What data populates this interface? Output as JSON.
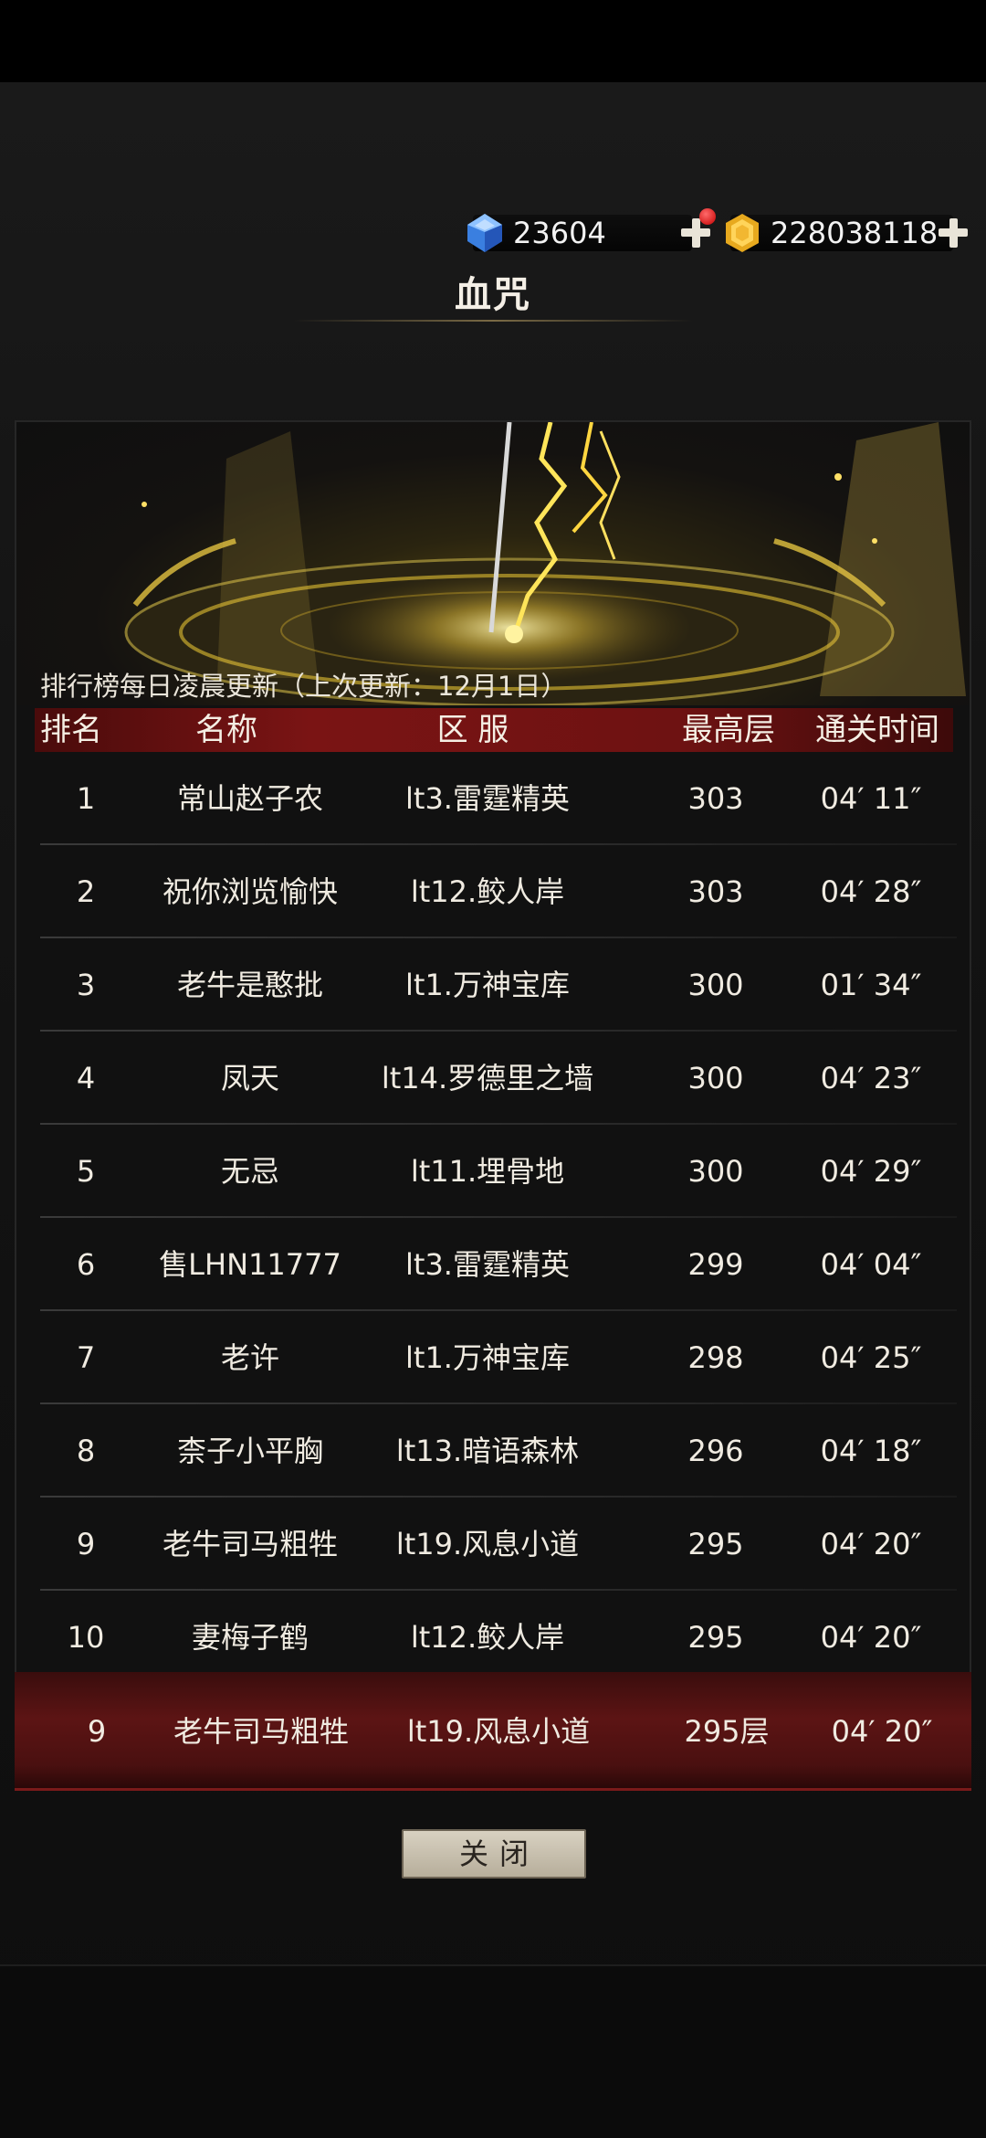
{
  "currency": {
    "gems": "23604",
    "gold": "228038118"
  },
  "title": "血咒",
  "update_note": "排行榜每日凌晨更新（上次更新：12月1日）",
  "headers": {
    "rank": "排名",
    "name": "名称",
    "server": "区 服",
    "floor": "最高层",
    "time": "通关时间"
  },
  "rows": [
    {
      "rank": "1",
      "name": "常山赵子农",
      "server": "lt3.雷霆精英",
      "floor": "303",
      "time": "04′ 11″"
    },
    {
      "rank": "2",
      "name": "祝你浏览愉快",
      "server": "lt12.鲛人岸",
      "floor": "303",
      "time": "04′ 28″"
    },
    {
      "rank": "3",
      "name": "老牛是憨批",
      "server": "lt1.万神宝库",
      "floor": "300",
      "time": "01′ 34″"
    },
    {
      "rank": "4",
      "name": "凤天",
      "server": "lt14.罗德里之墙",
      "floor": "300",
      "time": "04′ 23″"
    },
    {
      "rank": "5",
      "name": "无忌",
      "server": "lt11.埋骨地",
      "floor": "300",
      "time": "04′ 29″"
    },
    {
      "rank": "6",
      "name": "售LHN11777",
      "server": "lt3.雷霆精英",
      "floor": "299",
      "time": "04′ 04″"
    },
    {
      "rank": "7",
      "name": "老许",
      "server": "lt1.万神宝库",
      "floor": "298",
      "time": "04′ 25″"
    },
    {
      "rank": "8",
      "name": "柰子小平胸",
      "server": "lt13.暗语森林",
      "floor": "296",
      "time": "04′ 18″"
    },
    {
      "rank": "9",
      "name": "老牛司马粗牲",
      "server": "lt19.风息小道",
      "floor": "295",
      "time": "04′ 20″"
    },
    {
      "rank": "10",
      "name": "妻梅子鹤",
      "server": "lt12.鲛人岸",
      "floor": "295",
      "time": "04′ 20″"
    }
  ],
  "my_rank": {
    "rank": "9",
    "name": "老牛司马粗牲",
    "server": "lt19.风息小道",
    "floor": "295层",
    "time": "04′ 20″"
  },
  "close_label": "关闭"
}
